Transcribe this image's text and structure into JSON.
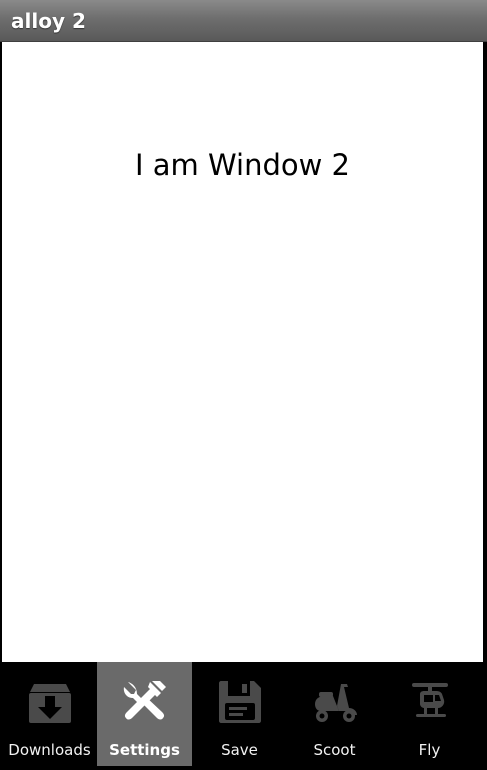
{
  "app": {
    "title": "alloy 2"
  },
  "window": {
    "label": "I am Window 2"
  },
  "tabs": [
    {
      "label": "Downloads",
      "icon": "download-box-icon",
      "selected": false
    },
    {
      "label": "Settings",
      "icon": "wrench-hammer-icon",
      "selected": true
    },
    {
      "label": "Save",
      "icon": "floppy-disk-icon",
      "selected": false
    },
    {
      "label": "Scoot",
      "icon": "scooter-icon",
      "selected": false
    },
    {
      "label": "Fly",
      "icon": "helicopter-icon",
      "selected": false
    }
  ],
  "colors": {
    "titlebar": "#6e6e6e",
    "active_tab": "#6a6a6a",
    "inactive_icon": "#4a4a4a",
    "active_icon": "#ffffff",
    "content_bg": "#ffffff",
    "tabbar_bg": "#000000"
  }
}
